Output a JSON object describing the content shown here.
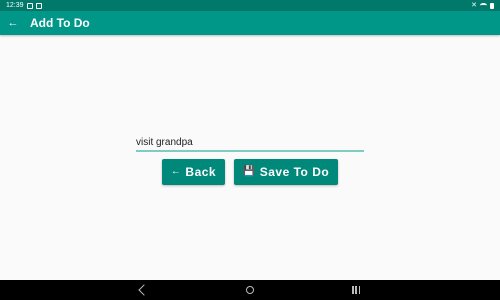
{
  "status_bar": {
    "time": "12:39"
  },
  "app_bar": {
    "title": "Add To Do",
    "back_icon": "arrow-left-icon"
  },
  "form": {
    "todo_value": "visit grandpa",
    "back_label": "Back",
    "back_icon": "arrow-left-icon",
    "save_label": "Save To Do",
    "save_icon": "floppy-disk-icon"
  },
  "colors": {
    "status_bar": "#00796b",
    "app_bar": "#009688",
    "button": "#00897b",
    "input_underline": "#80cbc4"
  }
}
